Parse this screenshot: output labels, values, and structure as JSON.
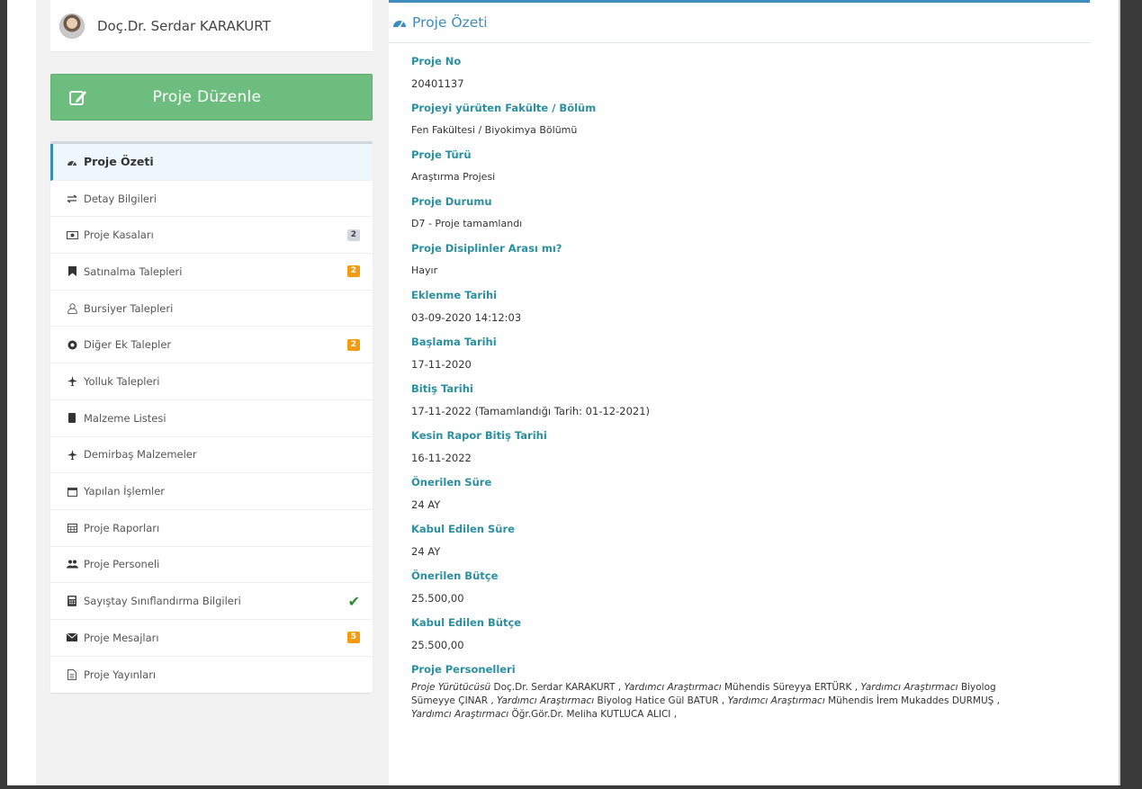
{
  "user": {
    "name": "Doç.Dr. Serdar KARAKURT"
  },
  "edit_button": {
    "label": "Proje Düzenle"
  },
  "menu": [
    {
      "label": "Proje Özeti",
      "icon": "dashboard-icon",
      "active": true
    },
    {
      "label": "Detay Bilgileri",
      "icon": "exchange-icon"
    },
    {
      "label": "Proje Kasaları",
      "icon": "money-icon",
      "badge": "2",
      "badge_color": "gray"
    },
    {
      "label": "Satınalma Talepleri",
      "icon": "bookmark-icon",
      "badge": "2",
      "badge_color": "orange"
    },
    {
      "label": "Bursiyer Talepleri",
      "icon": "user-icon"
    },
    {
      "label": "Diğer Ek Talepler",
      "icon": "circle-icon",
      "badge": "2",
      "badge_color": "orange"
    },
    {
      "label": "Yolluk Talepleri",
      "icon": "plane-icon"
    },
    {
      "label": "Malzeme Listesi",
      "icon": "book-icon"
    },
    {
      "label": "Demirbaş Malzemeler",
      "icon": "plane-icon"
    },
    {
      "label": "Yapılan İşlemler",
      "icon": "calendar-o-icon"
    },
    {
      "label": "Proje Raporları",
      "icon": "calendar-icon"
    },
    {
      "label": "Proje Personeli",
      "icon": "users-icon"
    },
    {
      "label": "Sayıştay Sınıflandırma Bilgileri",
      "icon": "calculator-icon",
      "check": true
    },
    {
      "label": "Proje Mesajları",
      "icon": "envelope-icon",
      "badge": "5",
      "badge_color": "orange"
    },
    {
      "label": "Proje Yayınları",
      "icon": "file-icon"
    }
  ],
  "main": {
    "title": "Proje Özeti",
    "fields": [
      {
        "label": "Proje No",
        "value": "20401137"
      },
      {
        "label": "Projeyi yürüten Fakülte / Bölüm",
        "value": "Fen Fakültesi / Biyokimya Bölümü"
      },
      {
        "label": "Proje Türü",
        "value": "Araştırma Projesi"
      },
      {
        "label": "Proje Durumu",
        "value": "D7 - Proje tamamlandı"
      },
      {
        "label": "Proje Disiplinler Arası mı?",
        "value": "Hayır"
      },
      {
        "label": "Eklenme Tarihi",
        "value": "03-09-2020 14:12:03"
      },
      {
        "label": "Başlama Tarihi",
        "value": "17-11-2020"
      },
      {
        "label": "Bitiş Tarihi",
        "value": "17-11-2022 (Tamamlandığı Tarih: 01-12-2021)"
      },
      {
        "label": "Kesin Rapor Bitiş Tarihi",
        "value": "16-11-2022"
      },
      {
        "label": "Önerilen Süre",
        "value": "24 AY"
      },
      {
        "label": "Kabul Edilen Süre",
        "value": "24 AY"
      },
      {
        "label": "Önerilen Bütçe",
        "value": "25.500,00"
      },
      {
        "label": "Kabul Edilen Bütçe",
        "value": "25.500,00"
      }
    ],
    "personnel_label": "Proje Personelleri",
    "personnel": [
      {
        "role": "Proje Yürütücüsü",
        "name": "Doç.Dr. Serdar KARAKURT ,"
      },
      {
        "role": "Yardımcı Araştırmacı",
        "name": "Mühendis Süreyya ERTÜRK ,"
      },
      {
        "role": "Yardımcı Araştırmacı",
        "name": "Biyolog Sümeyye ÇINAR ,"
      },
      {
        "role": "Yardımcı Araştırmacı",
        "name": "Biyolog Hatice Gül BATUR ,"
      },
      {
        "role": "Yardımcı Araştırmacı",
        "name": "Mühendis İrem Mukaddes DURMUŞ ,"
      },
      {
        "role": "Yardımcı Araştırmacı",
        "name": "Öğr.Gör.Dr. Meliha KUTLUCA ALICI ,"
      }
    ]
  },
  "colors": {
    "accent": "#3c8dbc",
    "green": "#6dbd7f",
    "label_teal": "#2b8f9f",
    "badge_orange": "#f39c12"
  }
}
